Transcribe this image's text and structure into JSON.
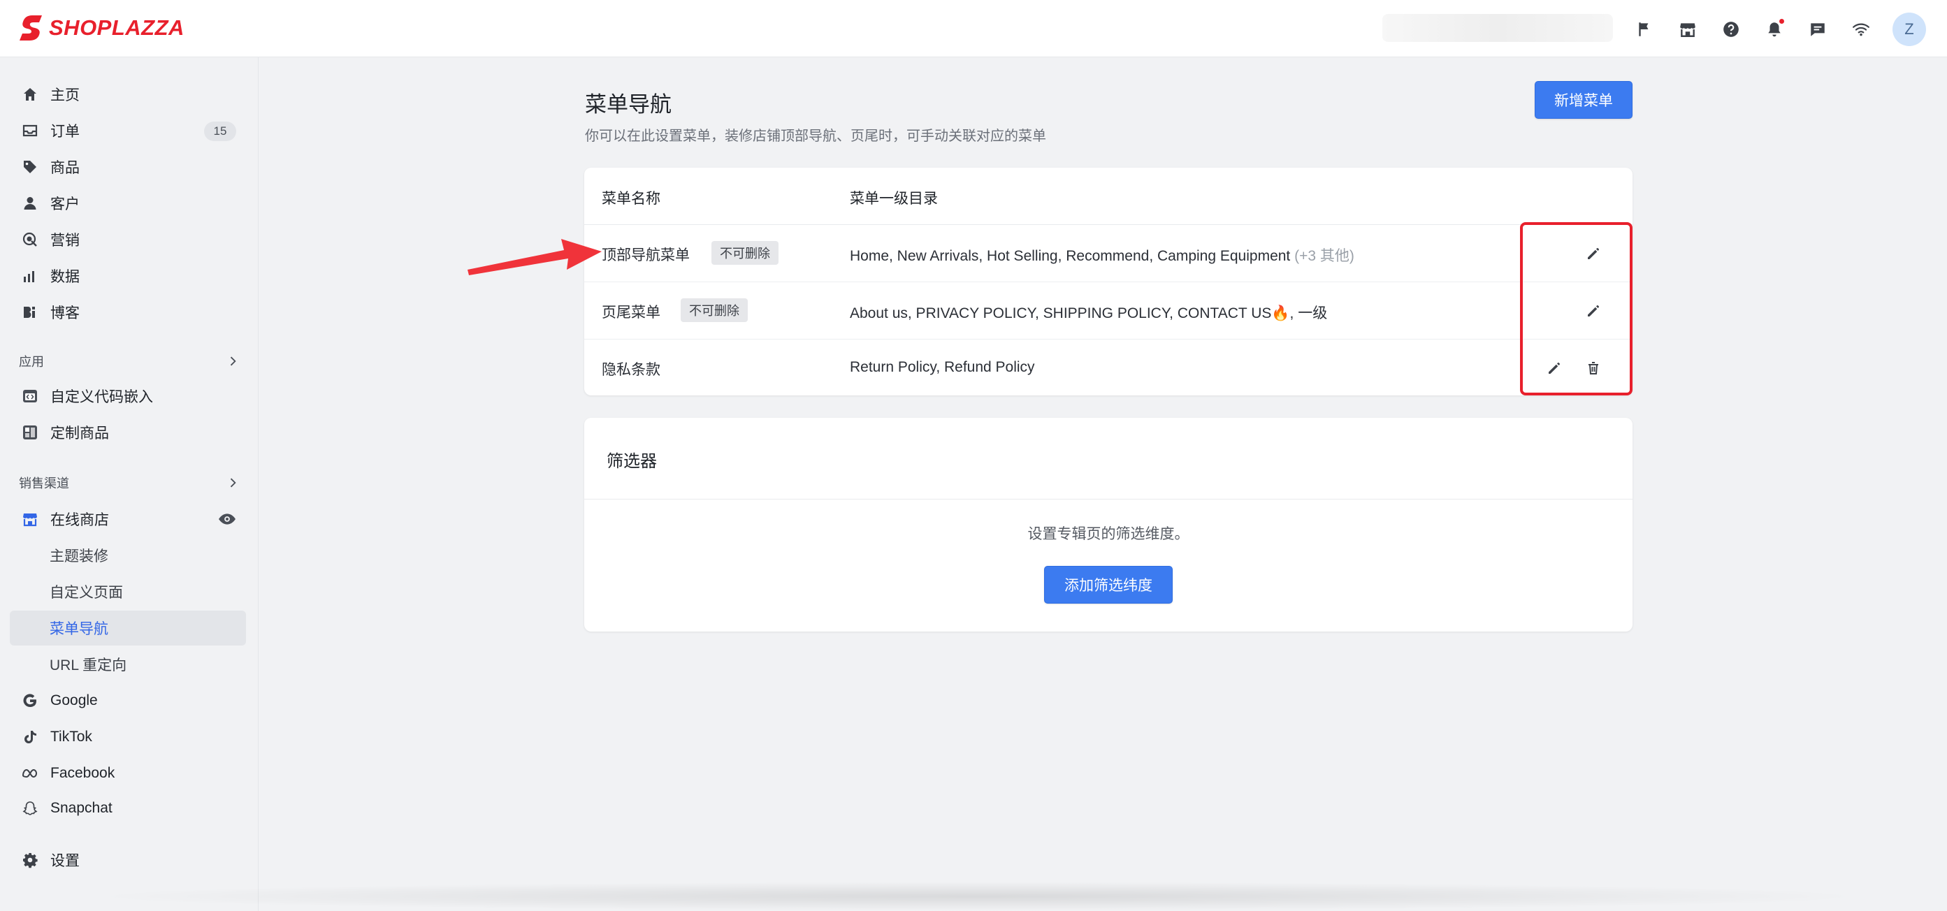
{
  "brand": {
    "name": "SHOPLAZZA",
    "color": "#e8202c"
  },
  "topbar": {
    "icons": [
      "flag-icon",
      "store-icon",
      "help-icon",
      "bell-icon",
      "chat-icon",
      "wifi-icon"
    ],
    "avatar_letter": "Z"
  },
  "sidebar": {
    "main_items": [
      {
        "label": "主页",
        "icon": "home-icon"
      },
      {
        "label": "订单",
        "icon": "inbox-icon",
        "badge": "15"
      },
      {
        "label": "商品",
        "icon": "tag-icon"
      },
      {
        "label": "客户",
        "icon": "person-icon"
      },
      {
        "label": "营销",
        "icon": "target-icon"
      },
      {
        "label": "数据",
        "icon": "bar-chart-icon"
      },
      {
        "label": "博客",
        "icon": "blog-icon"
      }
    ],
    "apps_label": "应用",
    "app_items": [
      {
        "label": "自定义代码嵌入",
        "icon": "code-embed-icon"
      },
      {
        "label": "定制商品",
        "icon": "custom-product-icon"
      }
    ],
    "channels_label": "销售渠道",
    "online_store": {
      "label": "在线商店",
      "icon": "storefront-icon"
    },
    "online_store_sub": [
      "主题装修",
      "自定义页面",
      "菜单导航",
      "URL 重定向"
    ],
    "channel_items": [
      {
        "label": "Google",
        "icon": "google-icon"
      },
      {
        "label": "TikTok",
        "icon": "tiktok-icon"
      },
      {
        "label": "Facebook",
        "icon": "meta-icon"
      },
      {
        "label": "Snapchat",
        "icon": "snapchat-icon"
      }
    ],
    "settings": {
      "label": "设置",
      "icon": "gear-icon"
    },
    "accent": "#3366e6"
  },
  "page": {
    "title": "菜单导航",
    "description": "你可以在此设置菜单，装修店铺顶部导航、页尾时，可手动关联对应的菜单",
    "add_button": "新增菜单"
  },
  "menu_table": {
    "headers": [
      "菜单名称",
      "菜单一级目录"
    ],
    "rows": [
      {
        "name": "顶部导航菜单",
        "tag": "不可删除",
        "directory": "Home, New Arrivals, Hot Selling, Recommend, Camping Equipment",
        "extra": "(+3 其他)",
        "actions": [
          "edit"
        ]
      },
      {
        "name": "页尾菜单",
        "tag": "不可删除",
        "directory": "About us, PRIVACY POLICY, SHIPPING POLICY, CONTACT US🔥, 一级",
        "extra": "",
        "actions": [
          "edit"
        ]
      },
      {
        "name": "隐私条款",
        "tag": "",
        "directory": "Return Policy, Refund Policy",
        "extra": "",
        "actions": [
          "edit",
          "delete"
        ]
      }
    ]
  },
  "filter_card": {
    "title": "筛选器",
    "description": "设置专辑页的筛选维度。",
    "button": "添加筛选纬度"
  },
  "colors": {
    "primary": "#3c7bf0",
    "annotation": "#e8202c"
  }
}
